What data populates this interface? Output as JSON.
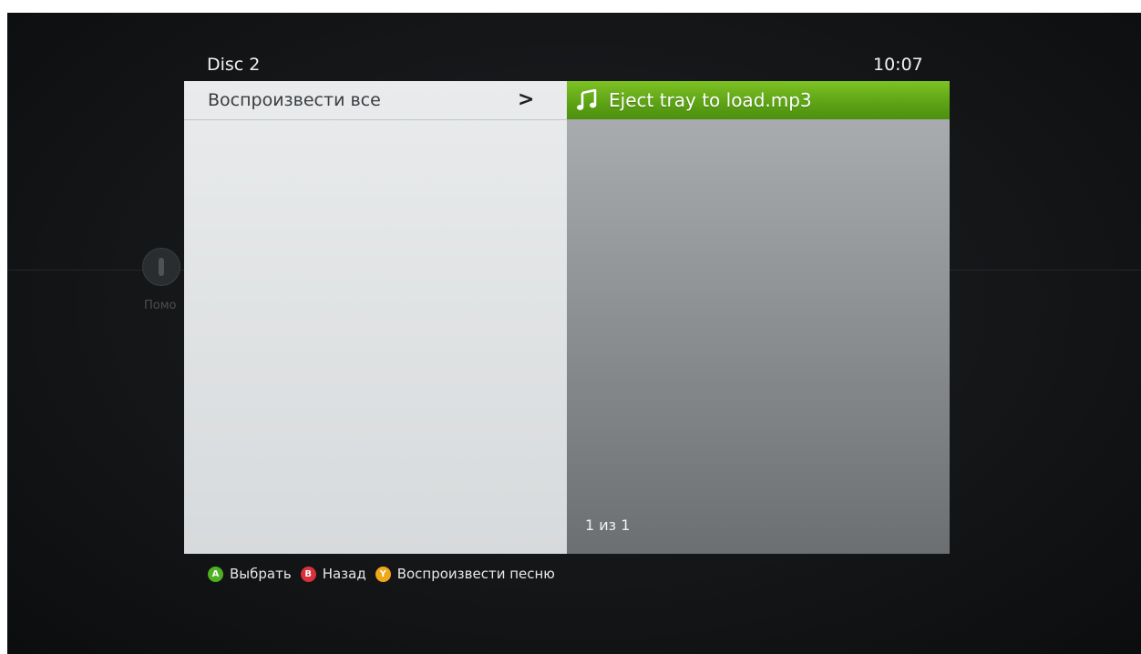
{
  "header": {
    "title": "Disc 2",
    "clock": "10:07"
  },
  "left_pane": {
    "play_all_label": "Воспроизвести все",
    "arrow_glyph": ">"
  },
  "right_pane": {
    "track": {
      "icon": "music-note-icon",
      "name": "Eject tray to load.mp3"
    },
    "page_counter": "1 из 1"
  },
  "background": {
    "help_label": "Помо"
  },
  "hints": [
    {
      "button": "A",
      "color": "#4fb022",
      "label": "Выбрать"
    },
    {
      "button": "B",
      "color": "#d9313a",
      "label": "Назад"
    },
    {
      "button": "Y",
      "color": "#f0a818",
      "label": "Воспроизвести песню"
    }
  ],
  "colors": {
    "highlight": "#5ea416",
    "background": "#141618",
    "left_pane": "#e3e5e6",
    "right_pane": "#8d9093"
  }
}
